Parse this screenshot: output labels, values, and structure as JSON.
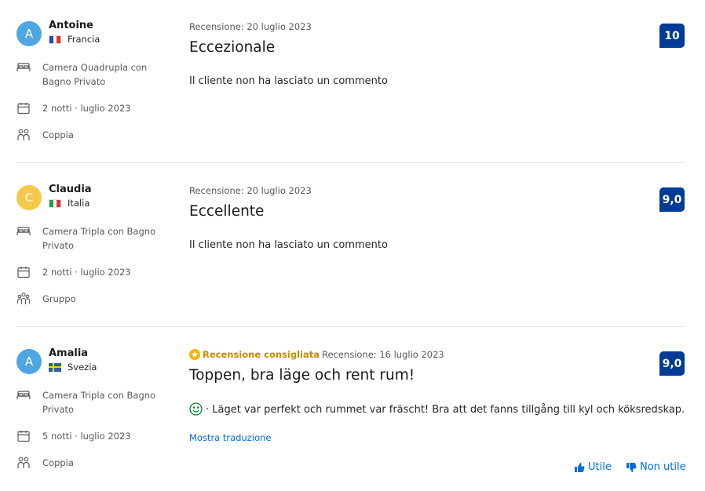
{
  "reviews": [
    {
      "initial": "A",
      "avatar_color": "#4ea6e2",
      "name": "Antoine",
      "country": "Francia",
      "flag_colors": [
        "#1f4bb5",
        "#ffffff",
        "#e03030"
      ],
      "room": "Camera Quadrupla con Bagno Privato",
      "stay": "2 notti · luglio 2023",
      "traveler_type": "Coppia",
      "traveler_icon": "couple-icon",
      "recommended_label": "",
      "date": "Recensione: 20 luglio 2023",
      "title": "Eccezionale",
      "text": "Il cliente non ha lasciato un commento",
      "score": "10"
    },
    {
      "initial": "C",
      "avatar_color": "#f7c948",
      "name": "Claudia",
      "country": "Italia",
      "flag_colors": [
        "#219e4a",
        "#ffffff",
        "#d93333"
      ],
      "room": "Camera Tripla con Bagno Privato",
      "stay": "2 notti · luglio 2023",
      "traveler_type": "Gruppo",
      "traveler_icon": "group-icon",
      "recommended_label": "",
      "date": "Recensione: 20 luglio 2023",
      "title": "Eccellente",
      "text": "Il cliente non ha lasciato un commento",
      "score": "9,0"
    },
    {
      "initial": "A",
      "avatar_color": "#4ea6e2",
      "name": "Amalia",
      "country": "Svezia",
      "flag_colors": [
        "#2f5fa8",
        "#f7cf2a"
      ],
      "room": "Camera Tripla con Bagno Privato",
      "stay": "5 notti · luglio 2023",
      "traveler_type": "Coppia",
      "traveler_icon": "couple-icon",
      "recommended_label": "Recensione consigliata",
      "date": "Recensione: 16 luglio 2023",
      "title": "Toppen, bra läge och rent rum!",
      "text": "· Läget var perfekt och rummet var fräscht! Bra att det fanns tillgång till kyl och köksredskap.",
      "translate_label": "Mostra traduzione",
      "score": "9,0"
    }
  ],
  "helpful": {
    "yes_label": "Utile",
    "no_label": "Non utile"
  },
  "colors": {
    "score_bg": "#003b95",
    "link": "#006ce4",
    "recommended": "#c68b00"
  }
}
